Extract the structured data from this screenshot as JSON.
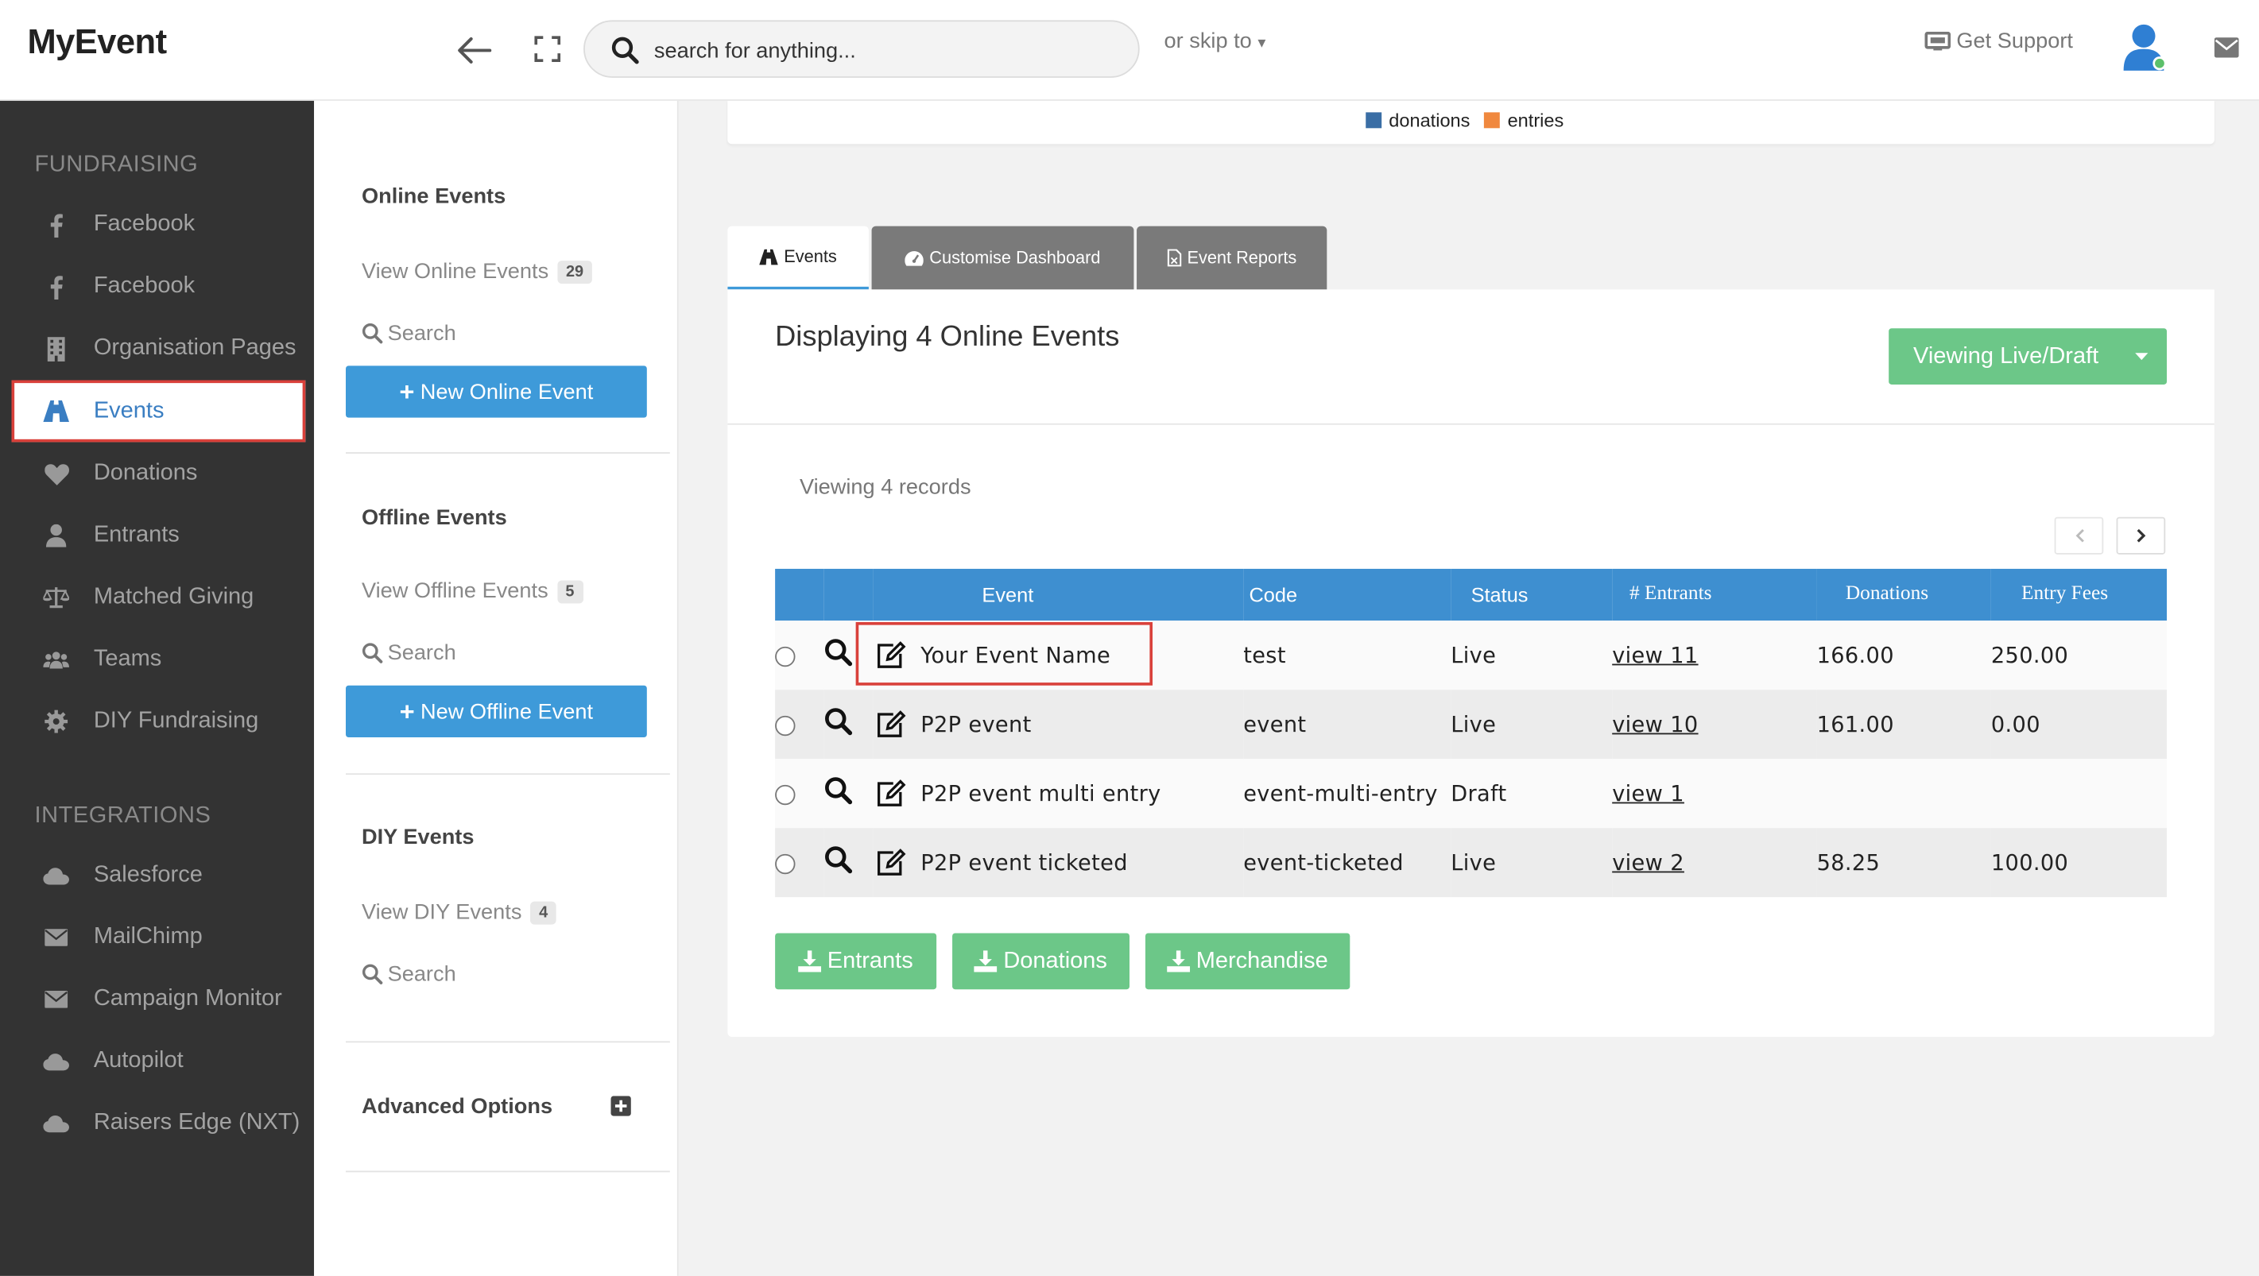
{
  "app": {
    "title": "MyEvent"
  },
  "topbar": {
    "search_placeholder": "search for anything...",
    "skip_label": "or skip to",
    "support_label": "Get Support"
  },
  "sidebar": {
    "sections": [
      {
        "title": "FUNDRAISING",
        "items": [
          {
            "label": "Facebook",
            "icon": "facebook-icon"
          },
          {
            "label": "Facebook",
            "icon": "facebook-icon"
          },
          {
            "label": "Organisation Pages",
            "icon": "building-icon"
          },
          {
            "label": "Events",
            "icon": "road-icon",
            "active": true
          },
          {
            "label": "Donations",
            "icon": "heart-icon"
          },
          {
            "label": "Entrants",
            "icon": "user-icon"
          },
          {
            "label": "Matched Giving",
            "icon": "balance-scale-icon"
          },
          {
            "label": "Teams",
            "icon": "users-icon"
          },
          {
            "label": "DIY Fundraising",
            "icon": "cog-icon"
          }
        ]
      },
      {
        "title": "INTEGRATIONS",
        "items": [
          {
            "label": "Salesforce",
            "icon": "cloud-icon"
          },
          {
            "label": "MailChimp",
            "icon": "envelope-icon"
          },
          {
            "label": "Campaign Monitor",
            "icon": "envelope-icon"
          },
          {
            "label": "Autopilot",
            "icon": "cloud-icon"
          },
          {
            "label": "Raisers Edge (NXT)",
            "icon": "cloud-icon"
          }
        ]
      }
    ]
  },
  "subnav": {
    "online": {
      "title": "Online Events",
      "view_label": "View Online Events",
      "count": "29",
      "search_label": "Search",
      "new_label": "New Online Event"
    },
    "offline": {
      "title": "Offline Events",
      "view_label": "View Offline Events",
      "count": "5",
      "search_label": "Search",
      "new_label": "New Offline Event"
    },
    "diy": {
      "title": "DIY Events",
      "view_label": "View DIY Events",
      "count": "4",
      "search_label": "Search"
    },
    "advanced": {
      "title": "Advanced Options"
    }
  },
  "legend": {
    "items": [
      {
        "label": "donations",
        "color": "#3a6ea5"
      },
      {
        "label": "entries",
        "color": "#f0883e"
      }
    ]
  },
  "tabs": [
    {
      "label": "Events",
      "icon": "road-icon",
      "active": true
    },
    {
      "label": "Customise Dashboard",
      "icon": "dashboard-icon"
    },
    {
      "label": "Event Reports",
      "icon": "file-icon"
    }
  ],
  "main": {
    "title": "Displaying 4 Online Events",
    "view_button": "Viewing Live/Draft",
    "records_label": "Viewing 4 records",
    "columns": [
      "Event",
      "Code",
      "Status",
      "# Entrants",
      "Donations",
      "Entry Fees"
    ],
    "rows": [
      {
        "event": "Your Event Name",
        "code": "test",
        "status": "Live",
        "entrants": "view 11",
        "donations": "166.00",
        "fees": "250.00"
      },
      {
        "event": "P2P event",
        "code": "event",
        "status": "Live",
        "entrants": "view 10",
        "donations": "161.00",
        "fees": "0.00"
      },
      {
        "event": "P2P event multi entry",
        "code": "event-multi-entry",
        "status": "Draft",
        "entrants": "view 1",
        "donations": "",
        "fees": ""
      },
      {
        "event": "P2P event ticketed",
        "code": "event-ticketed",
        "status": "Live",
        "entrants": "view 2",
        "donations": "58.25",
        "fees": "100.00"
      }
    ],
    "downloads": [
      "Entrants",
      "Donations",
      "Merchandise"
    ]
  },
  "colors": {
    "accent": "#3e9ad9",
    "success": "#6cc788",
    "sidebar": "#333333",
    "highlight": "#d9413b"
  }
}
